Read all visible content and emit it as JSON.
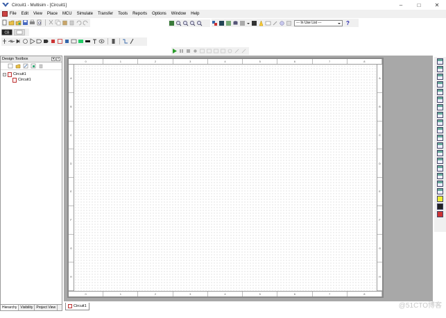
{
  "window": {
    "title": "Circuit1 - Multisim - [Circuit1]",
    "controls": [
      "–",
      "□",
      "✕"
    ]
  },
  "menu": [
    "File",
    "Edit",
    "View",
    "Place",
    "MCU",
    "Simulate",
    "Transfer",
    "Tools",
    "Reports",
    "Options",
    "Window",
    "Help"
  ],
  "toolbar": {
    "in_use_list": "--- In Use List ---",
    "help_glyph": "?"
  },
  "design_toolbox": {
    "title": "Design Toolbox",
    "tree_root": "Circuit1",
    "tree_child": "Circuit1",
    "tabs": [
      "Hierarchy",
      "Visibility",
      "Project View"
    ]
  },
  "ruler": {
    "columns": [
      "0",
      "1",
      "2",
      "3",
      "4",
      "5",
      "6",
      "7",
      "8"
    ],
    "rows": [
      "A",
      "B",
      "C",
      "D",
      "E",
      "F",
      "G",
      "H"
    ]
  },
  "document_tab": "Circuit1",
  "watermark": "@51CTO博客",
  "colors": {
    "workspace": "#a8a8a8",
    "chrome": "#f0f0f0",
    "run_green": "#2a9d2a"
  }
}
